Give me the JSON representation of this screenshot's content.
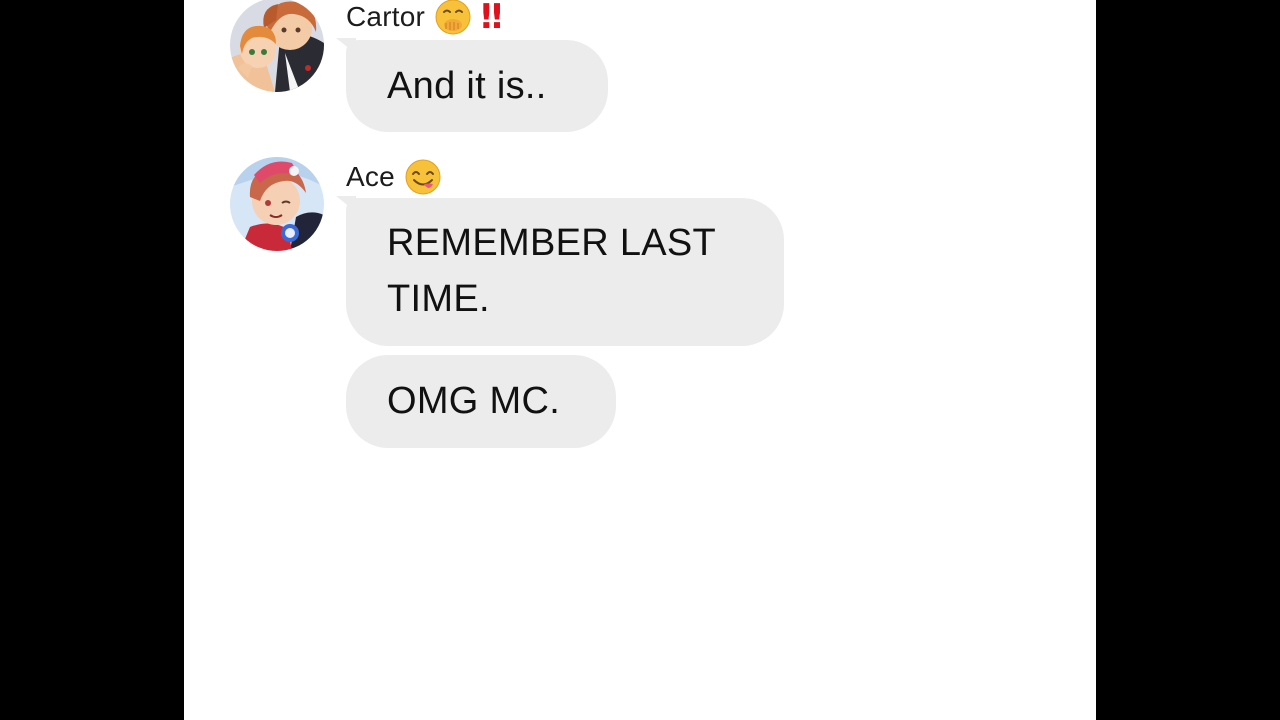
{
  "conversation": {
    "messages": [
      {
        "sender": "Cartor",
        "emoji_icons": [
          "hand-over-mouth-emoji-icon",
          "double-exclamation-icon"
        ],
        "bangs": "‼",
        "bubbles": [
          "And it is.."
        ]
      },
      {
        "sender": "Ace",
        "emoji_icons": [
          "face-savoring-food-emoji-icon"
        ],
        "bubbles": [
          "REMEMBER LAST TIME.",
          "OMG MC."
        ]
      }
    ]
  },
  "colors": {
    "outer_background": "#000000",
    "chat_background": "#ffffff",
    "bubble_background": "#ececec",
    "text": "#111111",
    "exclamation": "#e0101c"
  }
}
